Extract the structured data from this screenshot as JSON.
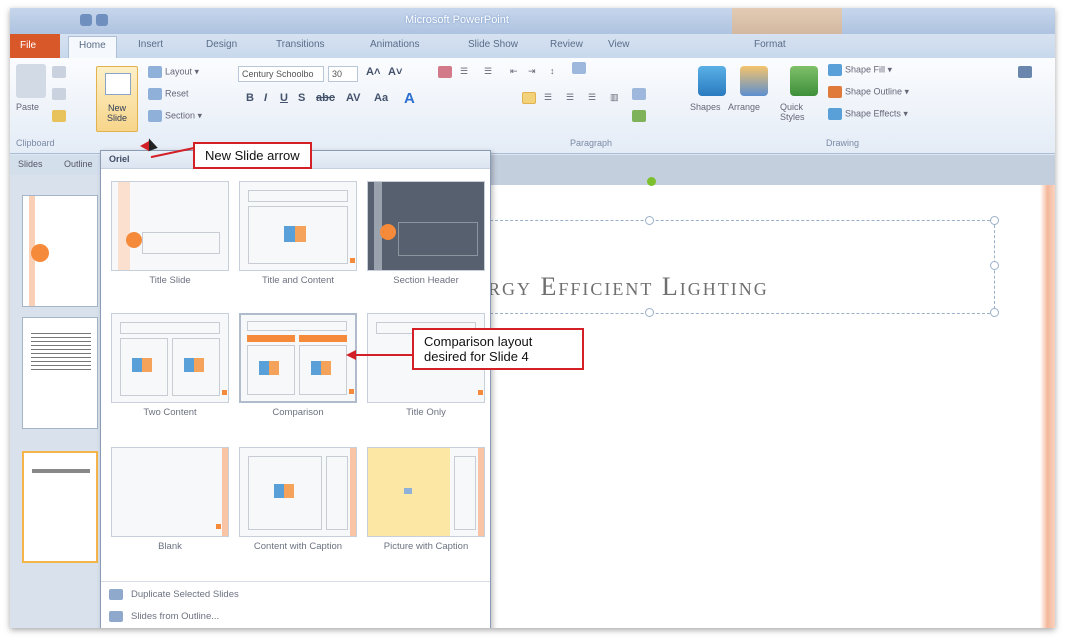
{
  "window": {
    "title": "Microsoft PowerPoint"
  },
  "tabs": [
    {
      "label": "File"
    },
    {
      "label": "Home"
    },
    {
      "label": "Insert"
    },
    {
      "label": "Design"
    },
    {
      "label": "Transitions"
    },
    {
      "label": "Animations"
    },
    {
      "label": "Slide Show"
    },
    {
      "label": "Review"
    },
    {
      "label": "View"
    },
    {
      "label": "Format"
    }
  ],
  "ribbon": {
    "clipboard": {
      "paste": "Paste",
      "group": "Clipboard"
    },
    "slides": {
      "new_slide": "New Slide",
      "layout": "Layout",
      "reset": "Reset",
      "section": "Section"
    },
    "font": {
      "name": "Century Schoolbo",
      "size": "30"
    },
    "paragraph": {
      "group": "Paragraph"
    },
    "drawing": {
      "shapes": "Shapes",
      "arrange": "Arrange",
      "quick_styles": "Quick Styles",
      "shape_fill": "Shape Fill",
      "shape_outline": "Shape Outline",
      "shape_effects": "Shape Effects",
      "group": "Drawing"
    }
  },
  "pane_tabs": {
    "slides": "Slides",
    "outline": "Outline"
  },
  "gallery": {
    "header": "Oriel",
    "layouts": [
      {
        "name": "Title Slide"
      },
      {
        "name": "Title and Content"
      },
      {
        "name": "Section Header"
      },
      {
        "name": "Two Content"
      },
      {
        "name": "Comparison"
      },
      {
        "name": "Title Only"
      },
      {
        "name": "Blank"
      },
      {
        "name": "Content with Caption"
      },
      {
        "name": "Picture with Caption"
      }
    ],
    "commands": [
      {
        "label": "Duplicate Selected Slides"
      },
      {
        "label": "Slides from Outline..."
      }
    ]
  },
  "slide": {
    "title_text": "rgy Efficient Lighting"
  },
  "callouts": {
    "new_slide_arrow": "New Slide arrow",
    "comparison": "Comparison layout desired for Slide 4"
  },
  "colors": {
    "accent_orange": "#f58a3a",
    "callout_red": "#d32027",
    "file_tab": "#d9582a",
    "section_dark": "#56606e",
    "picture_yellow": "#fce7a4"
  }
}
